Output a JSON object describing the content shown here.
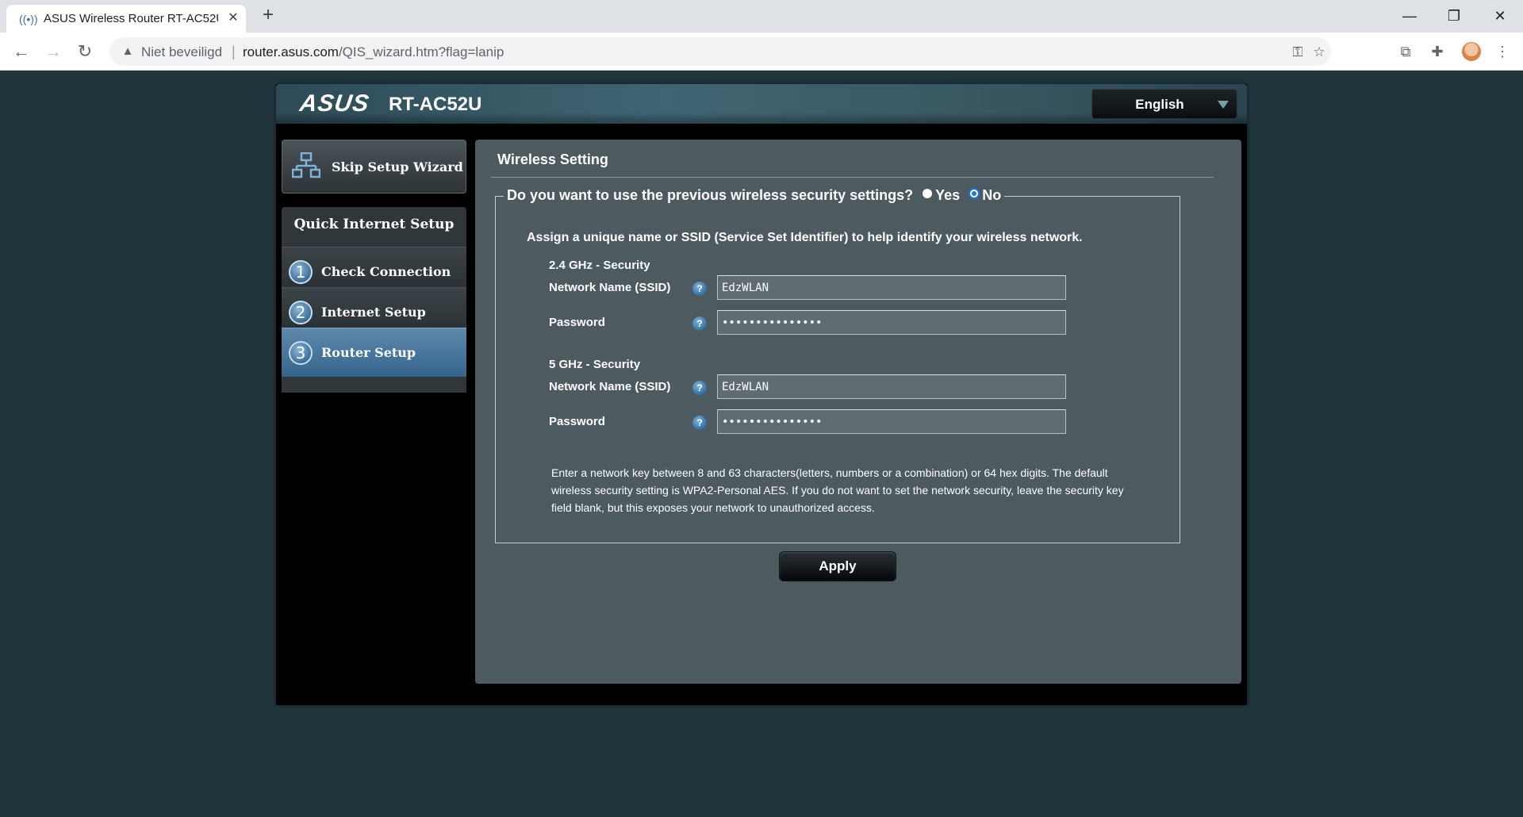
{
  "browser": {
    "tab_title": "ASUS Wireless Router RT-AC52U",
    "tab_close": "✕",
    "new_tab": "+",
    "security_label": "Niet beveiligd",
    "url_host": "router.asus.com",
    "url_path": "/QIS_wizard.htm?flag=lanip"
  },
  "router": {
    "brand": "ASUS",
    "model": "RT-AC52U",
    "language": "English",
    "skip_wizard": "Skip Setup Wizard",
    "qis_title": "Quick Internet Setup",
    "steps": [
      {
        "num": "1",
        "label": "Check Connection",
        "active": false
      },
      {
        "num": "2",
        "label": "Internet Setup",
        "active": false
      },
      {
        "num": "3",
        "label": "Router Setup",
        "active": true
      }
    ]
  },
  "wireless": {
    "title": "Wireless Setting",
    "question": "Do you want to use the previous wireless security settings?",
    "yes_label": "Yes",
    "no_label": "No",
    "selected": "No",
    "intro": "Assign a unique name or SSID (Service Set Identifier) to help identify your wireless network.",
    "band_24": {
      "heading": "2.4 GHz - Security",
      "ssid_label": "Network Name (SSID)",
      "ssid_value": "EdzWLAN",
      "password_label": "Password",
      "password_value": "•••••••••••••••"
    },
    "band_5": {
      "heading": "5 GHz - Security",
      "ssid_label": "Network Name (SSID)",
      "ssid_value": "EdzWLAN",
      "password_label": "Password",
      "password_value": "•••••••••••••••"
    },
    "note": "Enter a network key between 8 and 63 characters(letters, numbers or a combination) or 64 hex digits. The default wireless security setting is WPA2-Personal AES. If you do not want to set the network security, leave the security key field blank, but this exposes your network to unauthorized access.",
    "apply": "Apply"
  },
  "colors": {
    "page_bg": "#21353d",
    "panel_bg": "#4d5a5f",
    "active_step": "#35648b"
  },
  "icons": [
    "wifi-favicon",
    "back-icon",
    "forward-icon",
    "reload-icon",
    "warning-icon",
    "key-icon",
    "star-icon",
    "cast-icon",
    "extensions-icon",
    "menu-icon",
    "network-icon",
    "help-icon"
  ]
}
